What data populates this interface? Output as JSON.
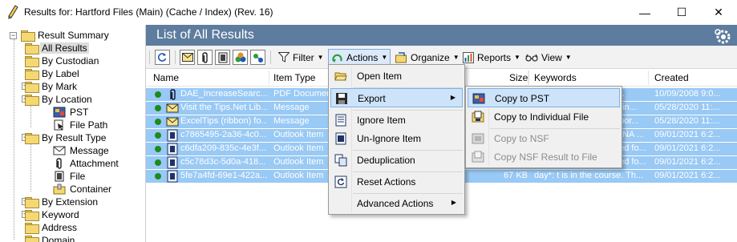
{
  "window": {
    "title": "Results for:  Hartford Files (Main) (Cache / Index) (Rev.  16)",
    "minimize": "—",
    "maximize": "☐",
    "close": "✕"
  },
  "tree": {
    "items": [
      {
        "label": "Result Summary",
        "icon": "folder-icon"
      },
      {
        "label": "All Results",
        "icon": "folder-icon"
      },
      {
        "label": "By Custodian",
        "icon": "folder-icon"
      },
      {
        "label": "By Label",
        "icon": "folder-icon"
      },
      {
        "label": "By Mark",
        "icon": "folder-icon"
      },
      {
        "label": "By Location",
        "icon": "folder-icon"
      },
      {
        "label": "PST",
        "icon": "pst-icon"
      },
      {
        "label": "File Path",
        "icon": "file-path-icon"
      },
      {
        "label": "By Result Type",
        "icon": "folder-icon"
      },
      {
        "label": "Message",
        "icon": "envelope-icon"
      },
      {
        "label": "Attachment",
        "icon": "paperclip-icon"
      },
      {
        "label": "File",
        "icon": "file-icon"
      },
      {
        "label": "Container",
        "icon": "container-icon"
      },
      {
        "label": "By Extension",
        "icon": "folder-icon"
      },
      {
        "label": "Keyword",
        "icon": "folder-icon"
      },
      {
        "label": "Address",
        "icon": "folder-icon"
      },
      {
        "label": "Domain",
        "icon": "folder-icon"
      }
    ]
  },
  "panel": {
    "title": "List of All Results"
  },
  "toolbar": {
    "filter": "Filter",
    "actions": "Actions",
    "organize": "Organize",
    "reports": "Reports",
    "view": "View"
  },
  "columns": {
    "name": "Name",
    "item_type": "Item Type",
    "size": "Size",
    "keywords": "Keywords",
    "created": "Created"
  },
  "rows": [
    {
      "name": "DAE_IncreaseSearc...",
      "type": "PDF Document",
      "size": "",
      "keywords": ":  ti...",
      "created": "10/09/2008 9:0...",
      "icon": "paperclip-icon"
    },
    {
      "name": "Visit the Tips.Net Lib...",
      "type": "Message",
      "size": "",
      "keywords": "ain...",
      "created": "05/28/2020 11:...",
      "icon": "envelope-icon"
    },
    {
      "name": "ExcelTips (ribbon) fo...",
      "type": "Message",
      "size": "",
      "keywords": "ppor...",
      "created": "05/28/2020 11:...",
      "icon": "envelope-icon"
    },
    {
      "name": "c7865495-2a36-4c0...",
      "type": "Outlook Item",
      "size": "",
      "keywords": "NA ...",
      "created": "09/01/2021 6:2...",
      "icon": "outlook-item-icon"
    },
    {
      "name": "c6dfa209-835c-4e3f...",
      "type": "Outlook Item",
      "size": "",
      "keywords": "ded fo...",
      "created": "09/01/2021 6:2...",
      "icon": "outlook-item-icon"
    },
    {
      "name": "c5c78d3c-5d0a-418...",
      "type": "Outlook Item",
      "size": "",
      "keywords": "ded fo...",
      "created": "09/01/2021 6:2...",
      "icon": "outlook-item-icon"
    },
    {
      "name": "5fe7a4fd-69e1-422a...",
      "type": "Outlook Item",
      "size": "67 KB",
      "keywords": "day*:  t is in the course. Th...",
      "created": "09/01/2021 6:2...",
      "icon": "outlook-item-icon"
    }
  ],
  "actions_menu": {
    "items": [
      {
        "label": "Open Item",
        "icon": "open-folder-icon"
      },
      {
        "label": "Export",
        "icon": "export-icon"
      },
      {
        "label": "Ignore Item",
        "icon": "ignore-icon"
      },
      {
        "label": "Un-Ignore Item",
        "icon": "unignore-icon"
      },
      {
        "label": "Deduplication",
        "icon": "dedup-icon"
      },
      {
        "label": "Reset Actions",
        "icon": "reset-icon"
      },
      {
        "label": "Advanced Actions",
        "icon": ""
      }
    ]
  },
  "export_menu": {
    "items": [
      {
        "label": "Copy to PST",
        "icon": "pst-copy-icon",
        "enabled": true
      },
      {
        "label": "Copy to Individual File",
        "icon": "file-copy-icon",
        "enabled": true
      },
      {
        "label": "Copy to NSF",
        "icon": "nsf-copy-icon",
        "enabled": false
      },
      {
        "label": "Copy NSF Result to File",
        "icon": "nsf-file-icon",
        "enabled": false
      }
    ]
  },
  "colors": {
    "header": "#5d7c9e",
    "selection": "#99c9f5",
    "menu_highlight": "#cde3f9",
    "status_dot": "#1e8a1e"
  }
}
